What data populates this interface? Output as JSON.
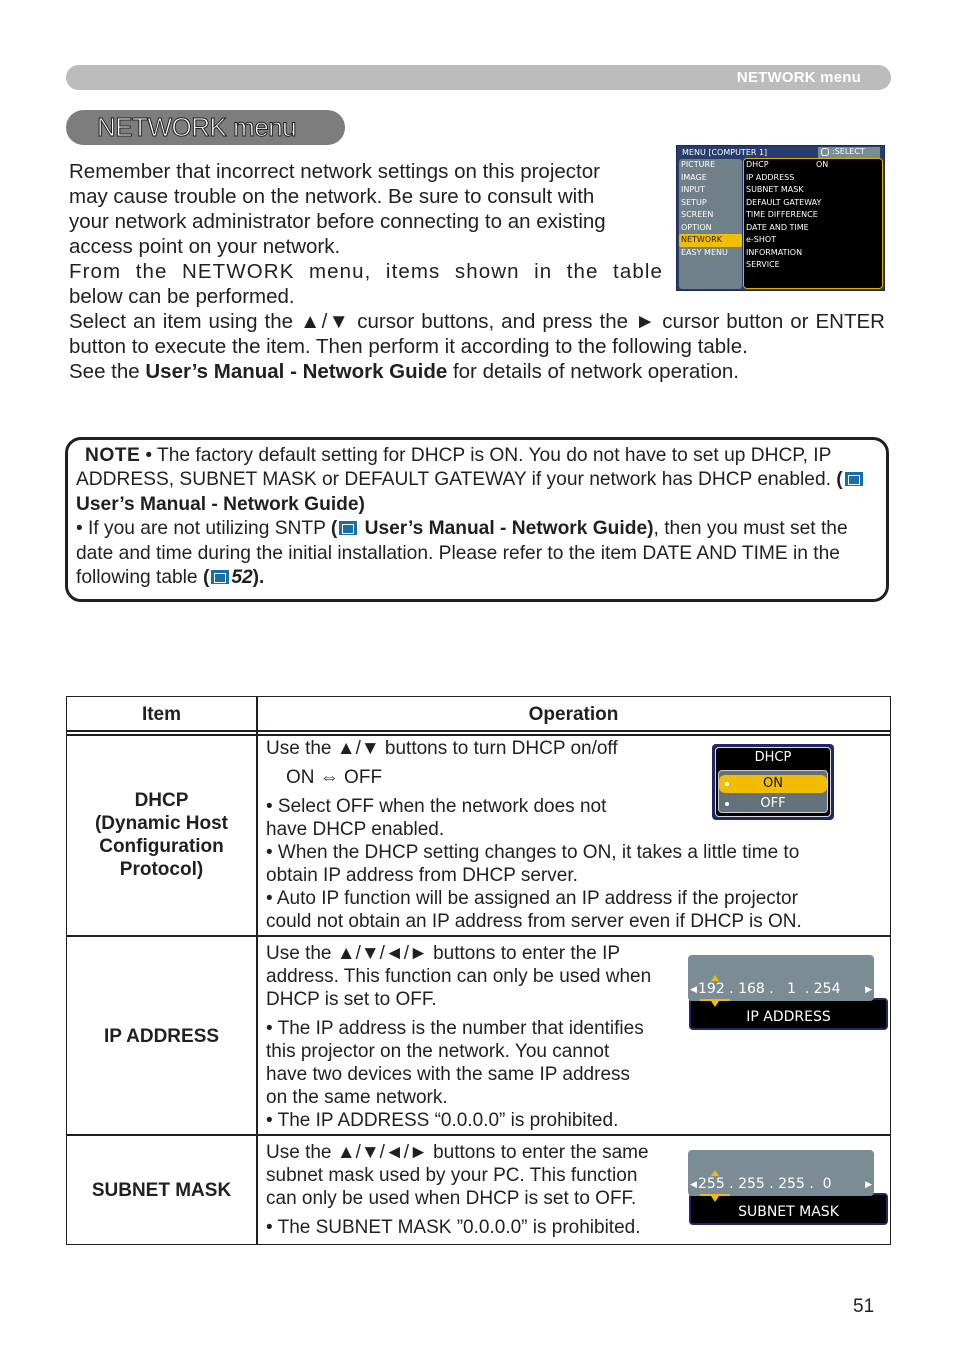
{
  "header": {
    "section_label": "NETWORK menu"
  },
  "title": "NETWORK menu",
  "intro": {
    "p1_lines": [
      "Remember that incorrect network settings on this projector",
      "may cause trouble on the network. Be sure to consult with",
      "your network administrator before connecting to an existing",
      "access point on your network."
    ],
    "p2_line1": "From the NETWORK menu, items shown in the table",
    "p2_line2": "below can be performed.",
    "p3": "Select an item using the ▲/▼ cursor buttons, and press the ► cursor button or ENTER button to execute the item. Then perform it according to the following table.",
    "p4_pre": "See the ",
    "p4_bold": "User’s Manual - Network Guide",
    "p4_post": " for details of network operation."
  },
  "menu_osd": {
    "title": "MENU [COMPUTER 1]",
    "select_label": ":SELECT",
    "left_items": [
      "PICTURE",
      "IMAGE",
      "INPUT",
      "SETUP",
      "SCREEN",
      "OPTION",
      "NETWORK",
      "EASY MENU"
    ],
    "active_left": "NETWORK",
    "right_items": [
      {
        "label": "DHCP",
        "value": "ON"
      },
      {
        "label": "IP ADDRESS",
        "value": ""
      },
      {
        "label": "SUBNET MASK",
        "value": ""
      },
      {
        "label": "DEFAULT GATEWAY",
        "value": ""
      },
      {
        "label": "TIME DIFFERENCE",
        "value": ""
      },
      {
        "label": "DATE AND TIME",
        "value": ""
      },
      {
        "label": "e-SHOT",
        "value": ""
      },
      {
        "label": "INFORMATION",
        "value": ""
      },
      {
        "label": "SERVICE",
        "value": ""
      }
    ]
  },
  "note": {
    "label": "NOTE",
    "p1_text": "• The factory default setting for DHCP is ON. You do not have to set up DHCP, IP ADDRESS, SUBNET MASK or DEFAULT GATEWAY if your network has DHCP enabled. ",
    "p1_ref_open": "(",
    "p1_ref_bold": " User’s Manual - Network Guide)",
    "p2_pre": "• If you are not utilizing SNTP ",
    "p2_ref_open": "(",
    "p2_ref_bold": " User’s Manual - Network Guide)",
    "p2_post": ", then you must set the date and time during the initial installation. Please refer to the item DATE AND TIME in the following table ",
    "p2_page_open": "(",
    "p2_page": "52",
    "p2_page_close": ").",
    "book_icon": "book-icon"
  },
  "table": {
    "headers": {
      "item": "Item",
      "operation": "Operation"
    },
    "rows": [
      {
        "item_lines": [
          "DHCP",
          "(Dynamic Host",
          "Configuration",
          "Protocol)"
        ],
        "op": [
          "Use the ▲/▼ buttons to turn DHCP on/off",
          "ON ⇔ OFF",
          "• Select OFF when the network does not",
          "have  DHCP enabled.",
          "• When the DHCP setting changes to ON, it takes a little time to",
          "obtain IP address from DHCP server.",
          "• Auto IP function will be assigned an IP address if the projector",
          "could not obtain an IP address from server even if DHCP is ON."
        ],
        "osd": {
          "title": "DHCP",
          "options": [
            "ON",
            "OFF"
          ],
          "selected": "ON"
        }
      },
      {
        "item_lines": [
          "IP ADDRESS"
        ],
        "op": [
          "Use the ▲/▼/◄/► buttons to enter the IP",
          "address. This function can only be used when",
          "DHCP is set to OFF.",
          "• The IP address is the number that identifies",
          "this projector on the network. You cannot",
          "have two devices with the same IP address",
          "on the same network.",
          "• The IP ADDRESS “0.0.0.0” is prohibited."
        ],
        "osd": {
          "label": "IP ADDRESS",
          "value": "192 . 168 .   1  . 254"
        }
      },
      {
        "item_lines": [
          "SUBNET MASK"
        ],
        "op": [
          "Use the ▲/▼/◄/► buttons to enter the same",
          "subnet mask used by your PC. This function",
          "can only be used when DHCP is set to OFF.",
          "• The SUBNET MASK ”0.0.0.0” is prohibited."
        ],
        "osd": {
          "label": "SUBNET MASK",
          "value": "255 . 255 . 255 .  0"
        }
      }
    ]
  },
  "page_number": "51"
}
